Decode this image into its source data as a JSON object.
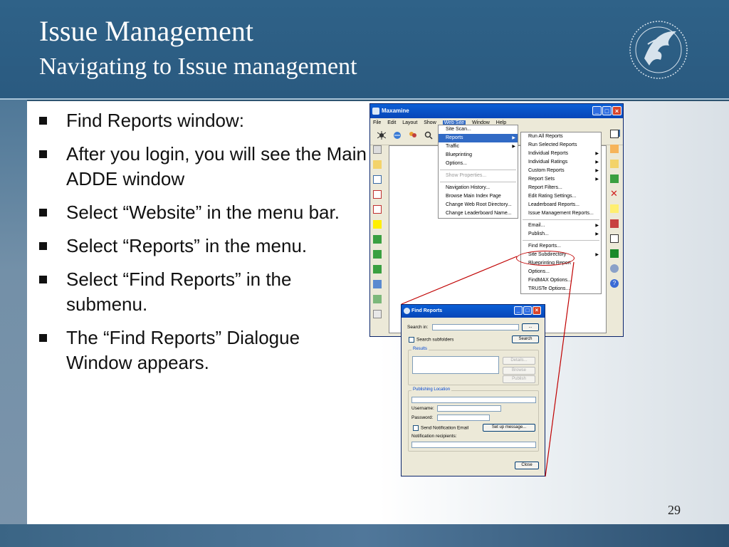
{
  "slide": {
    "title": "Issue Management",
    "subtitle": "Navigating to Issue management",
    "page_number": "29",
    "bullets": [
      "Find Reports window:",
      "After you login, you will see the Main ADDE window",
      "Select “Website” in the menu bar.",
      "Select “Reports” in the menu.",
      "Select “Find Reports” in the submenu.",
      "The “Find Reports” Dialogue Window appears."
    ]
  },
  "app": {
    "title": "Maxamine",
    "menubar": [
      "File",
      "Edit",
      "Layout",
      "Show",
      "Web Site",
      "Window",
      "Help"
    ],
    "website_menu": [
      {
        "label": "Site Scan...",
        "arrow": false
      },
      {
        "label": "Reports",
        "arrow": true,
        "highlight": true
      },
      {
        "label": "Traffic",
        "arrow": true
      },
      {
        "label": "Blueprinting",
        "arrow": false
      },
      {
        "label": "Options...",
        "arrow": false
      },
      {
        "label": "Show Properties...",
        "arrow": false,
        "disabled": true
      },
      {
        "label": "Navigation History...",
        "arrow": false
      },
      {
        "label": "Browse Main Index Page",
        "arrow": false
      },
      {
        "label": "Change Web Root Directory...",
        "arrow": false
      },
      {
        "label": "Change Leaderboard Name...",
        "arrow": false
      }
    ],
    "reports_menu": [
      {
        "label": "Run All Reports",
        "arrow": false
      },
      {
        "label": "Run Selected Reports",
        "arrow": false
      },
      {
        "label": "Individual Reports",
        "arrow": true
      },
      {
        "label": "Individual Ratings",
        "arrow": true
      },
      {
        "label": "Custom Reports",
        "arrow": true
      },
      {
        "label": "Report Sets",
        "arrow": true
      },
      {
        "label": "Report Filters...",
        "arrow": false
      },
      {
        "label": "Edit Rating Settings...",
        "arrow": false
      },
      {
        "label": "Leaderboard Reports...",
        "arrow": false
      },
      {
        "label": "Issue Management Reports...",
        "arrow": false
      },
      {
        "label": "Email...",
        "arrow": true
      },
      {
        "label": "Publish...",
        "arrow": true
      },
      {
        "label": "Find Reports...",
        "arrow": false
      },
      {
        "label": "Site Subdirectory",
        "arrow": true
      },
      {
        "label": "Blueprinting Report",
        "arrow": false
      },
      {
        "label": "Options...",
        "arrow": false
      },
      {
        "label": "FindMAX Options...",
        "arrow": false
      },
      {
        "label": "TRUSTe Options...",
        "arrow": false
      }
    ]
  },
  "dialog": {
    "title": "Find Reports",
    "search_in_label": "Search in:",
    "browse_label": "...",
    "search_subfolders_label": "Search subfolders",
    "search_button": "Search",
    "results_label": "Results",
    "details_button": "Details...",
    "browse_button": "Browse",
    "publish_button": "Publish",
    "publishing_location_label": "Publishing Location",
    "username_label": "Username:",
    "password_label": "Password:",
    "send_email_label": "Send Notification Email",
    "setup_message_button": "Set up message...",
    "recipients_label": "Notification recipients:",
    "close_button": "Close"
  },
  "colors": {
    "header_bg": "#2f6288",
    "titlebar": "#0a5fd6",
    "menu_highlight": "#316ac5",
    "callout": "#c00000"
  }
}
